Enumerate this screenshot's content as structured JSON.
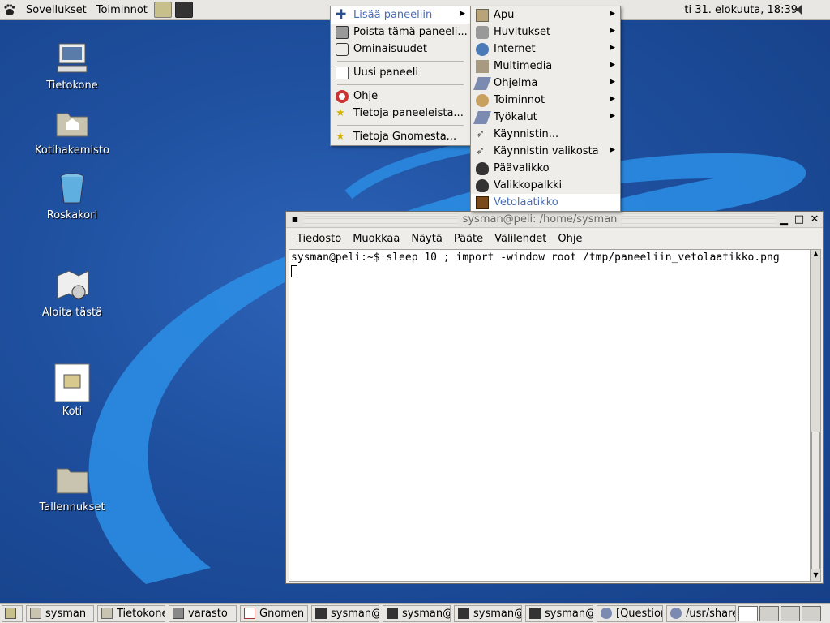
{
  "top_panel": {
    "menus": [
      "Sovellukset",
      "Toiminnot"
    ],
    "launchers": [
      "text-editor-icon",
      "terminal-icon"
    ],
    "clock": "ti 31. elokuuta, 18:39",
    "volume_icon": "volume-icon"
  },
  "desktop_icons": [
    {
      "label": "Tietokone",
      "icon": "computer-icon"
    },
    {
      "label": "Kotihakemisto",
      "icon": "home-folder-icon"
    },
    {
      "label": "Roskakori",
      "icon": "trash-icon"
    },
    {
      "label": "Aloita tästä",
      "icon": "start-here-icon"
    },
    {
      "label": "Koti",
      "icon": "document-icon"
    },
    {
      "label": "Tallennukset",
      "icon": "folder-icon"
    }
  ],
  "panel_menu": {
    "items": [
      {
        "label": "Lisää paneeliin",
        "icon": "add-icon",
        "submenu": true,
        "active": true
      },
      {
        "label": "Poista tämä paneeli...",
        "icon": "remove-panel-icon"
      },
      {
        "label": "Ominaisuudet",
        "icon": "properties-icon"
      },
      {
        "label": "Uusi paneeli",
        "icon": "new-panel-icon"
      },
      {
        "label": "Ohje",
        "icon": "help-icon"
      },
      {
        "label": "Tietoja paneeleista...",
        "icon": "about-icon"
      },
      {
        "label": "Tietoja Gnomesta...",
        "icon": "about-icon"
      }
    ]
  },
  "add_submenu": {
    "items": [
      {
        "label": "Apu",
        "submenu": true
      },
      {
        "label": "Huvitukset",
        "submenu": true
      },
      {
        "label": "Internet",
        "submenu": true
      },
      {
        "label": "Multimedia",
        "submenu": true
      },
      {
        "label": "Ohjelma",
        "submenu": true
      },
      {
        "label": "Toiminnot",
        "submenu": true
      },
      {
        "label": "Työkalut",
        "submenu": true
      },
      {
        "label": "Käynnistin...",
        "submenu": false
      },
      {
        "label": "Käynnistin valikosta",
        "submenu": true
      },
      {
        "label": "Päävalikko",
        "submenu": false
      },
      {
        "label": "Valikkopalkki",
        "submenu": false
      },
      {
        "label": "Vetolaatikko",
        "submenu": false,
        "highlighted": true
      }
    ]
  },
  "terminal": {
    "title": "sysman@peli: /home/sysman",
    "menus": [
      "Tiedosto",
      "Muokkaa",
      "Näytä",
      "Pääte",
      "Välilehdet",
      "Ohje"
    ],
    "line1": "sysman@peli:~$ sleep 10 ; import -window root /tmp/paneeliin_vetolaatikko.png"
  },
  "taskbar": {
    "tasks": [
      {
        "label": "sysman",
        "icon": "folder-icon"
      },
      {
        "label": "Tietokone",
        "icon": "folder-icon"
      },
      {
        "label": "varasto",
        "icon": "network-icon"
      },
      {
        "label": "Gnomen P",
        "icon": "document-icon"
      },
      {
        "label": "sysman@",
        "icon": "terminal-icon"
      },
      {
        "label": "sysman@",
        "icon": "terminal-icon"
      },
      {
        "label": "sysman@",
        "icon": "terminal-icon"
      },
      {
        "label": "sysman@",
        "icon": "terminal-icon"
      },
      {
        "label": "[Question",
        "icon": "browser-icon"
      },
      {
        "label": "/usr/share",
        "icon": "browser-icon"
      }
    ],
    "workspaces": 4,
    "current_workspace": 1
  }
}
